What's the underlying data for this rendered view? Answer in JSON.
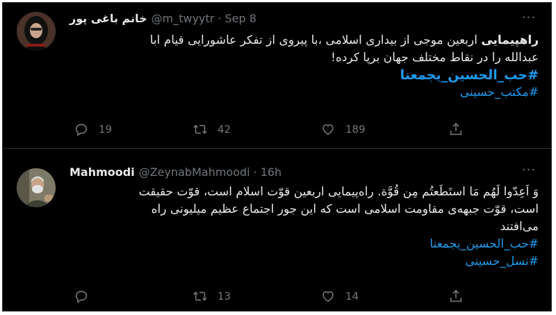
{
  "tweets": [
    {
      "display_name": "خانم باغی پور",
      "handle": "@m_twyytr",
      "separator": "·",
      "time": "Sep 8",
      "more": "···",
      "body_lead": "راهپیمایی",
      "body_line1_rest": " اربعین موجی از بیداری اسلامی ،با پیروی از تفکر عاشورایی قیام ابا",
      "body_line2": "عبدالله را در نقاط مختلف جهان برپا کرده!",
      "hashtags": [
        "#حب_الحسین_یجمعنا",
        "#مکتب_حسینی"
      ],
      "replies": "19",
      "retweets": "42",
      "likes": "189"
    },
    {
      "display_name": "Mahmoodi",
      "handle": "@ZeynabMahmoodi",
      "separator": "·",
      "time": "16h",
      "more": "···",
      "body_line1": "وَ اَعِدّوا لَهُم مَا استَطَعتُم مِن قُوَّة. راه‌پیمایی اربعین قوّت اسلام است، قوّت حقیقت",
      "body_line2": "است، قوّت جبهه‌ی مقاومت اسلامی است که این جور اجتماع عظیم میلیونی راه",
      "body_line3": "می‌افتند",
      "hashtags": [
        "#حب_الحسین_یجمعنا",
        "#نسل_حسینی"
      ],
      "replies": "",
      "retweets": "13",
      "likes": "14"
    }
  ],
  "icons": {
    "reply": "reply-icon",
    "retweet": "retweet-icon",
    "like": "like-icon",
    "share": "share-icon"
  },
  "colors": {
    "background": "#000000",
    "text": "#e7e9ea",
    "muted": "#71767b",
    "link": "#1d9bf0",
    "divider": "#2f3336"
  }
}
